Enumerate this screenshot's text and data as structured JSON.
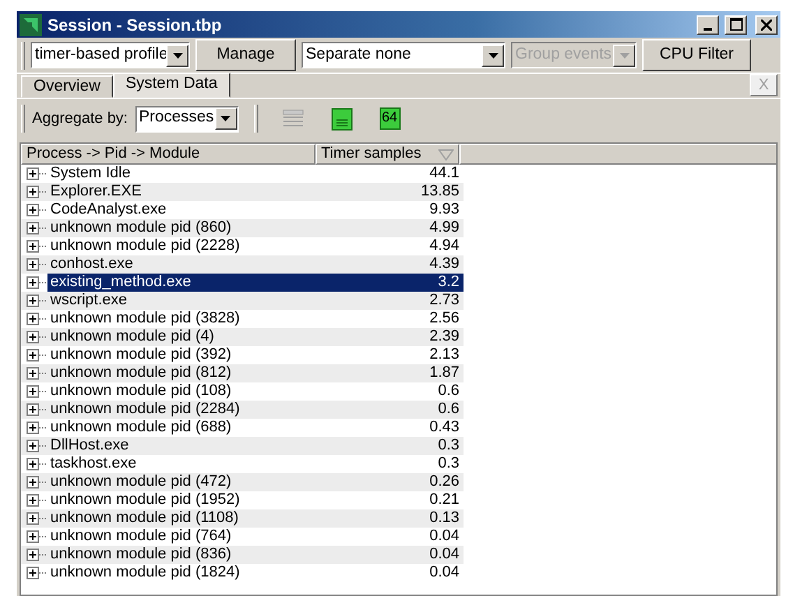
{
  "window": {
    "title": "Session - Session.tbp"
  },
  "toolbar": {
    "profile": "timer-based profile",
    "manage": "Manage",
    "separate": "Separate none",
    "group_events": {
      "label": "Group events",
      "disabled": true
    },
    "cpu_filter": "CPU Filter"
  },
  "tabs": [
    {
      "label": "Overview",
      "selected": false
    },
    {
      "label": "System Data",
      "selected": true
    }
  ],
  "close_tab": "X",
  "aggregate": {
    "label": "Aggregate by:",
    "value": "Processes"
  },
  "view_buttons": [
    {
      "kind": "grid",
      "disabled": true
    },
    {
      "kind": "page",
      "disabled": false
    },
    {
      "kind": "text",
      "label": "64",
      "disabled": false
    }
  ],
  "table": {
    "columns": [
      "Process -> Pid -> Module",
      "Timer samples"
    ],
    "rows": [
      {
        "name": "System Idle",
        "value": "44.1",
        "selected": false
      },
      {
        "name": "Explorer.EXE",
        "value": "13.85",
        "selected": false
      },
      {
        "name": "CodeAnalyst.exe",
        "value": "9.93",
        "selected": false
      },
      {
        "name": "unknown module pid (860)",
        "value": "4.99",
        "selected": false
      },
      {
        "name": "unknown module pid (2228)",
        "value": "4.94",
        "selected": false
      },
      {
        "name": "conhost.exe",
        "value": "4.39",
        "selected": false
      },
      {
        "name": "existing_method.exe",
        "value": "3.2",
        "selected": true
      },
      {
        "name": "wscript.exe",
        "value": "2.73",
        "selected": false
      },
      {
        "name": "unknown module pid (3828)",
        "value": "2.56",
        "selected": false
      },
      {
        "name": "unknown module pid (4)",
        "value": "2.39",
        "selected": false
      },
      {
        "name": "unknown module pid (392)",
        "value": "2.13",
        "selected": false
      },
      {
        "name": "unknown module pid (812)",
        "value": "1.87",
        "selected": false
      },
      {
        "name": "unknown module pid (108)",
        "value": "0.6",
        "selected": false
      },
      {
        "name": "unknown module pid (2284)",
        "value": "0.6",
        "selected": false
      },
      {
        "name": "unknown module pid (688)",
        "value": "0.43",
        "selected": false
      },
      {
        "name": "DllHost.exe",
        "value": "0.3",
        "selected": false
      },
      {
        "name": "taskhost.exe",
        "value": "0.3",
        "selected": false
      },
      {
        "name": "unknown module pid (472)",
        "value": "0.26",
        "selected": false
      },
      {
        "name": "unknown module pid (1952)",
        "value": "0.21",
        "selected": false
      },
      {
        "name": "unknown module pid (1108)",
        "value": "0.13",
        "selected": false
      },
      {
        "name": "unknown module pid (764)",
        "value": "0.04",
        "selected": false
      },
      {
        "name": "unknown module pid (836)",
        "value": "0.04",
        "selected": false
      },
      {
        "name": "unknown module pid (1824)",
        "value": "0.04",
        "selected": false
      }
    ]
  }
}
